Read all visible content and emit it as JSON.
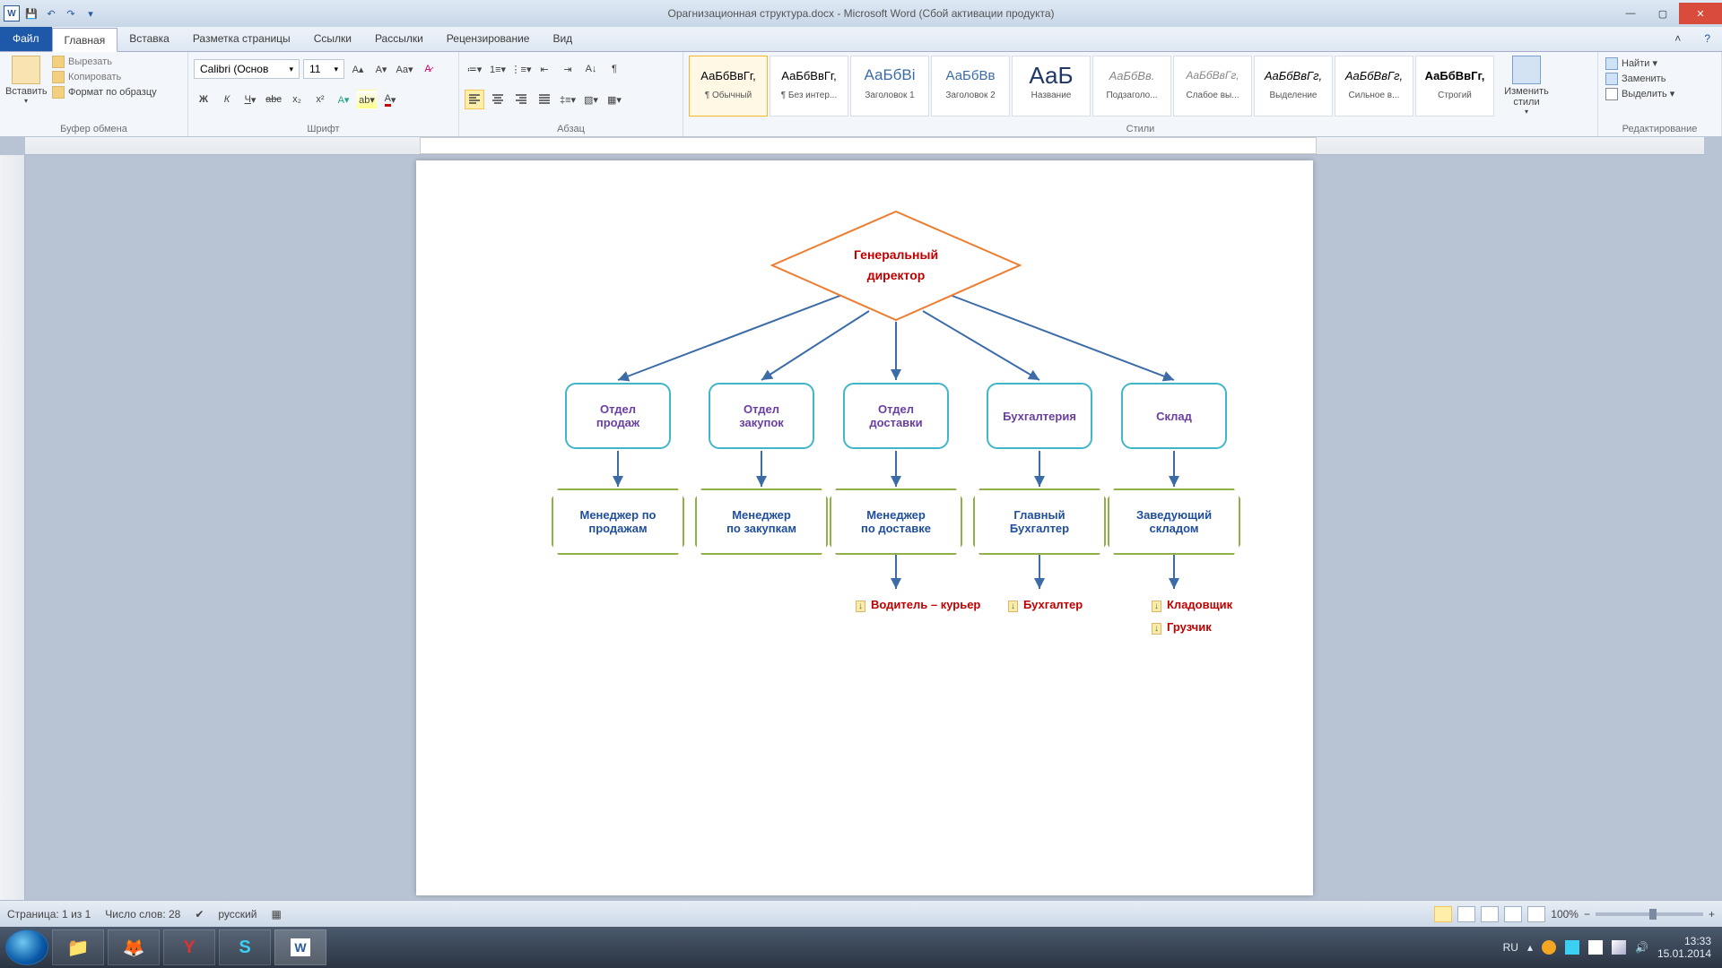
{
  "title": "Орагнизационная структура.docx - Microsoft Word (Сбой активации продукта)",
  "tabs": {
    "file": "Файл",
    "home": "Главная",
    "insert": "Вставка",
    "layout": "Разметка страницы",
    "refs": "Ссылки",
    "mail": "Рассылки",
    "review": "Рецензирование",
    "view": "Вид"
  },
  "clipboard": {
    "group": "Буфер обмена",
    "paste": "Вставить",
    "cut": "Вырезать",
    "copy": "Копировать",
    "format_painter": "Формат по образцу"
  },
  "font": {
    "group": "Шрифт",
    "name": "Calibri (Основ",
    "size": "11"
  },
  "paragraph": {
    "group": "Абзац"
  },
  "styles": {
    "group": "Стили",
    "change": "Изменить стили",
    "items": [
      {
        "prev": "АаБбВвГг,",
        "label": "¶ Обычный"
      },
      {
        "prev": "АаБбВвГг,",
        "label": "¶ Без интер..."
      },
      {
        "prev": "АаБбВі",
        "label": "Заголовок 1"
      },
      {
        "prev": "АаБбВв",
        "label": "Заголовок 2"
      },
      {
        "prev": "АаБ",
        "label": "Название"
      },
      {
        "prev": "АаБбВв.",
        "label": "Подзаголо..."
      },
      {
        "prev": "АаБбВвГг,",
        "label": "Слабое вы..."
      },
      {
        "prev": "АаБбВвГг,",
        "label": "Выделение"
      },
      {
        "prev": "АаБбВвГг,",
        "label": "Сильное в..."
      },
      {
        "prev": "АаБбВвГг,",
        "label": "Строгий"
      }
    ]
  },
  "editing": {
    "group": "Редактирование",
    "find": "Найти",
    "replace": "Заменить",
    "select": "Выделить"
  },
  "chart_data": {
    "type": "org-chart",
    "root": {
      "text_l1": "Генеральный",
      "text_l2": "директор"
    },
    "departments": [
      {
        "l1": "Отдел",
        "l2": "продаж"
      },
      {
        "l1": "Отдел",
        "l2": "закупок"
      },
      {
        "l1": "Отдел",
        "l2": "доставки"
      },
      {
        "l1": "Бухгалтерия",
        "l2": ""
      },
      {
        "l1": "Склад",
        "l2": ""
      }
    ],
    "managers": [
      {
        "l1": "Менеджер по",
        "l2": "продажам"
      },
      {
        "l1": "Менеджер",
        "l2": "по закупкам"
      },
      {
        "l1": "Менеджер",
        "l2": "по доставке"
      },
      {
        "l1": "Главный",
        "l2": "Бухгалтер"
      },
      {
        "l1": "Заведующий",
        "l2": "складом"
      }
    ],
    "staff": {
      "col2": [
        "Водитель – курьер"
      ],
      "col3": [
        "Бухгалтер"
      ],
      "col4": [
        "Кладовщик",
        "Грузчик"
      ]
    }
  },
  "status": {
    "page": "Страница: 1 из 1",
    "words": "Число слов: 28",
    "lang": "русский",
    "zoom": "100%"
  },
  "tray": {
    "kb": "RU",
    "time": "13:33",
    "date": "15.01.2014"
  }
}
